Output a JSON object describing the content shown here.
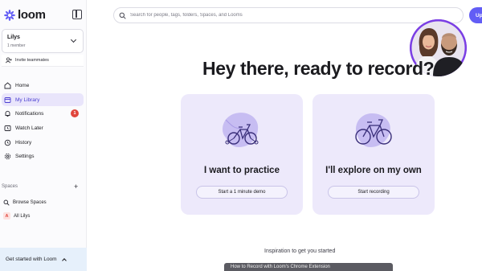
{
  "app": {
    "name": "loom",
    "accent": "#625df5"
  },
  "sidebar": {
    "workspace": {
      "name": "Lilys",
      "members": "1 member"
    },
    "invite_label": "Invite teammates",
    "nav": [
      {
        "label": "Home",
        "icon": "home-icon"
      },
      {
        "label": "My Library",
        "icon": "library-icon",
        "active": true
      },
      {
        "label": "Notifications",
        "icon": "bell-icon",
        "badge": "1"
      },
      {
        "label": "Watch Later",
        "icon": "clock-icon"
      },
      {
        "label": "History",
        "icon": "history-icon"
      },
      {
        "label": "Settings",
        "icon": "gear-icon"
      }
    ],
    "spaces": {
      "label": "Spaces",
      "add_symbol": "+",
      "items": [
        {
          "label": "Browse Spaces",
          "icon": "search-icon"
        },
        {
          "label": "All Lilys",
          "avatar_letter": "A"
        }
      ]
    },
    "get_started_label": "Get started with Loom"
  },
  "header": {
    "search_placeholder": "Search for people, tags, folders, Spaces, and Looms",
    "upgrade_label": "Up"
  },
  "main": {
    "headline": "Hey there, ready to record?",
    "cards": [
      {
        "title": "I want to practice",
        "button": "Start a 1 minute demo",
        "illustration": "practice-bike-icon"
      },
      {
        "title": "I'll explore on my own",
        "button": "Start recording",
        "illustration": "bike-icon"
      }
    ],
    "inspiration_label": "Inspiration to get you started",
    "video_title_partial": "How to Record with Loom's Chrome Extension"
  }
}
